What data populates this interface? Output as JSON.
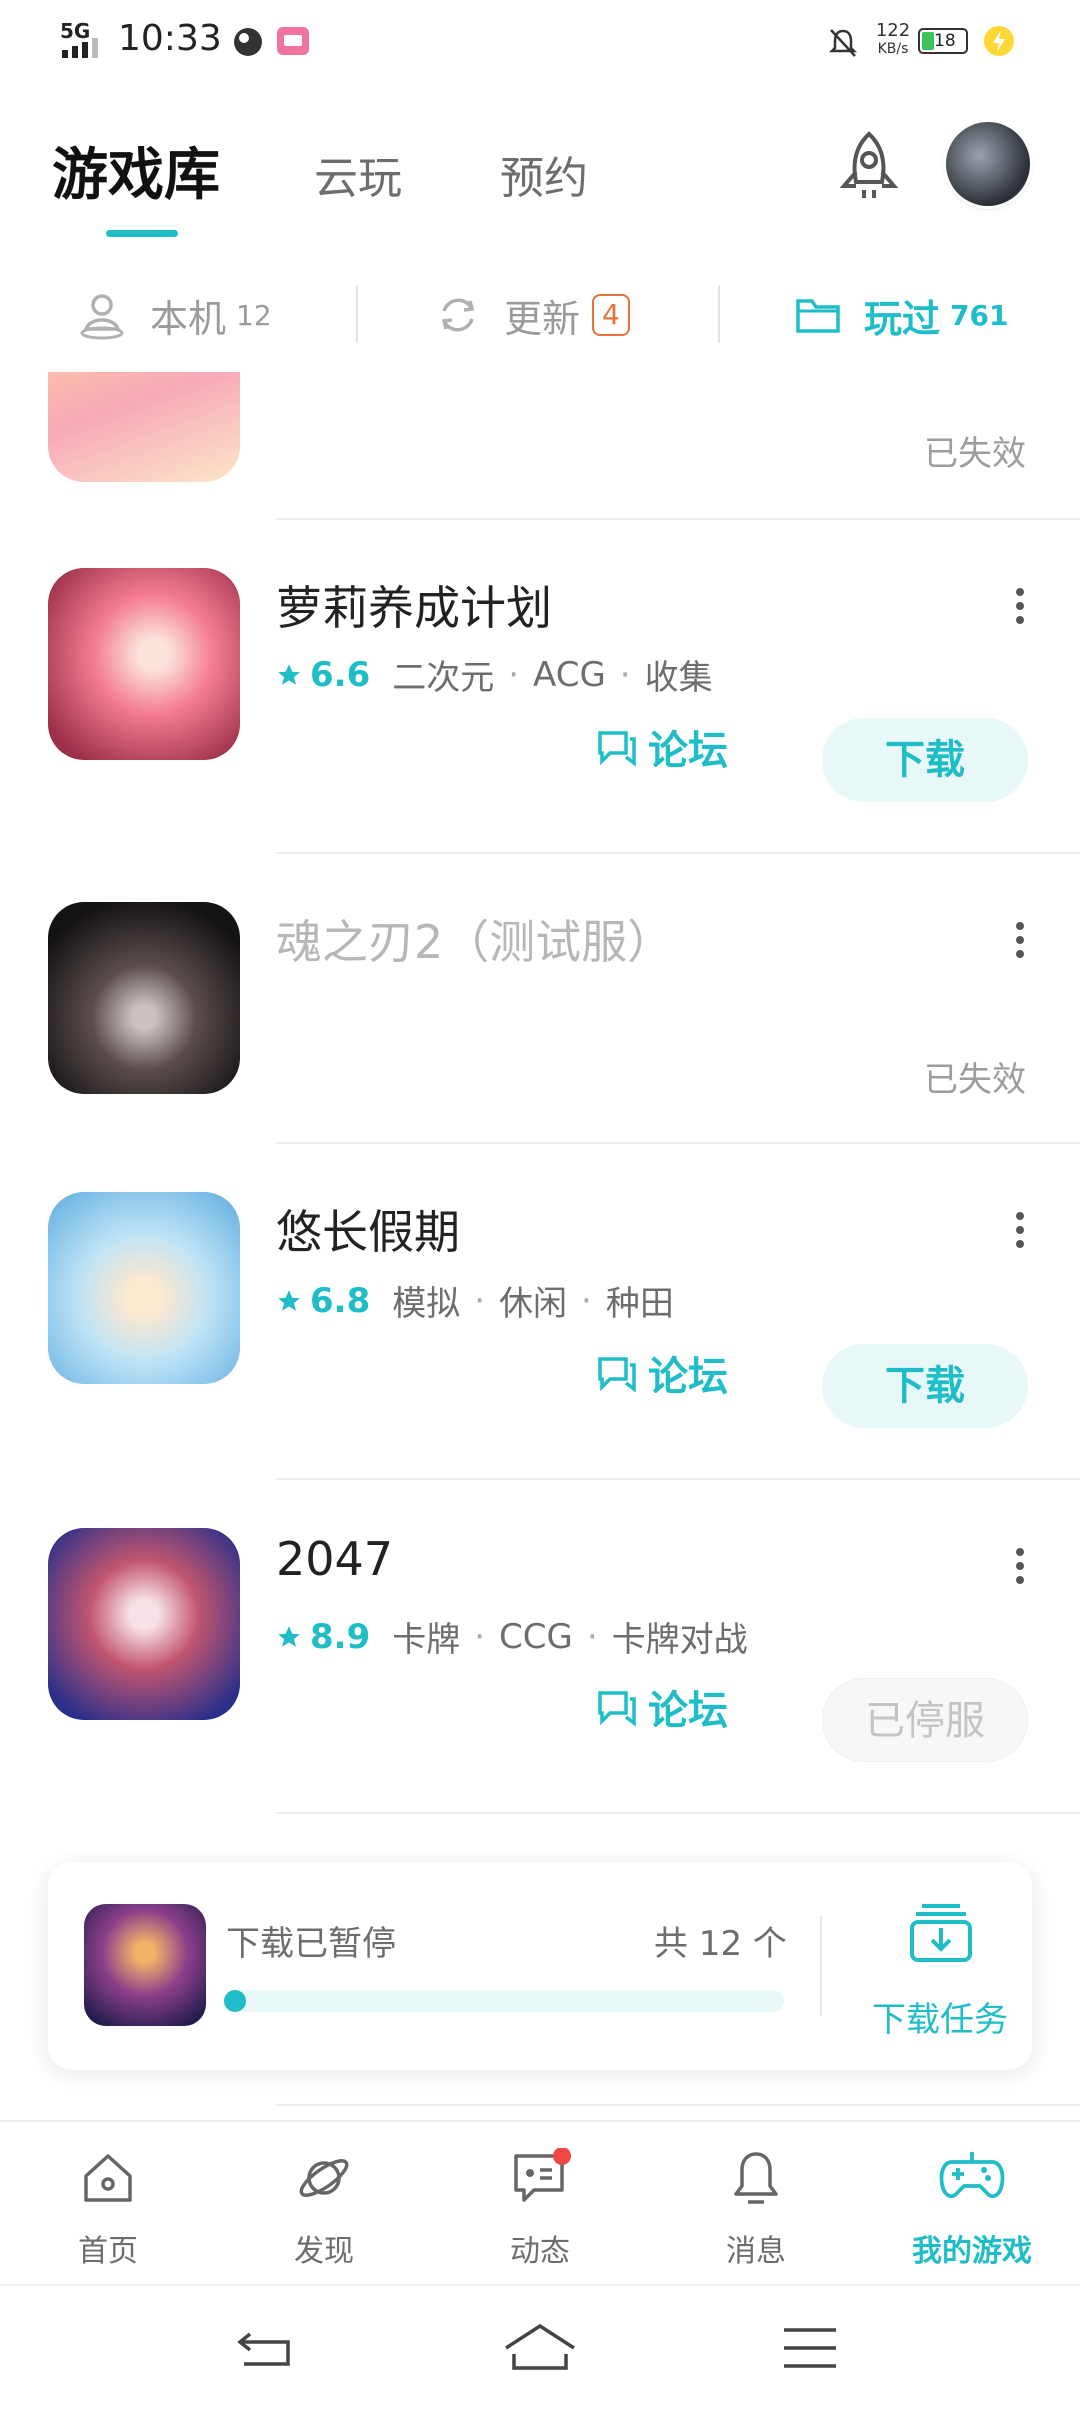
{
  "status": {
    "network": "5G",
    "time": "10:33",
    "speed_top": "122",
    "speed_unit": "KB/s",
    "battery": "18"
  },
  "header": {
    "tabs": [
      {
        "label": "游戏库",
        "active": true
      },
      {
        "label": "云玩",
        "active": false
      },
      {
        "label": "预约",
        "active": false
      }
    ],
    "rocket_icon": "rocket-icon",
    "avatar": "avatar"
  },
  "segments": [
    {
      "label": "本机",
      "count": "12",
      "icon": "person-icon"
    },
    {
      "label": "更新",
      "count": "4",
      "icon": "refresh-icon"
    },
    {
      "label": "玩过",
      "count": "761",
      "icon": "folder-icon"
    }
  ],
  "games": [
    {
      "title": "",
      "status": "已失效"
    },
    {
      "title": "萝莉养成计划",
      "rating": "6.6",
      "tags": [
        "二次元",
        "ACG",
        "收集"
      ],
      "forum": "论坛",
      "action": "下载"
    },
    {
      "title": "魂之刃2（测试服）",
      "status": "已失效"
    },
    {
      "title": "悠长假期",
      "rating": "6.8",
      "tags": [
        "模拟",
        "休闲",
        "种田"
      ],
      "forum": "论坛",
      "action": "下载"
    },
    {
      "title": "2047",
      "rating": "8.9",
      "tags": [
        "卡牌",
        "CCG",
        "卡牌对战"
      ],
      "forum": "论坛",
      "action": "已停服"
    }
  ],
  "download_card": {
    "status": "下载已暂停",
    "total": "共 12 个",
    "button": "下载任务",
    "progress": 0.03
  },
  "bottom_nav": [
    {
      "label": "首页",
      "icon": "home-icon"
    },
    {
      "label": "发现",
      "icon": "planet-icon"
    },
    {
      "label": "动态",
      "icon": "message-icon"
    },
    {
      "label": "消息",
      "icon": "bell-icon"
    },
    {
      "label": "我的游戏",
      "icon": "gamepad-icon",
      "active": true
    }
  ],
  "colors": {
    "accent": "#1fbdc7",
    "badge": "#e8733a"
  }
}
